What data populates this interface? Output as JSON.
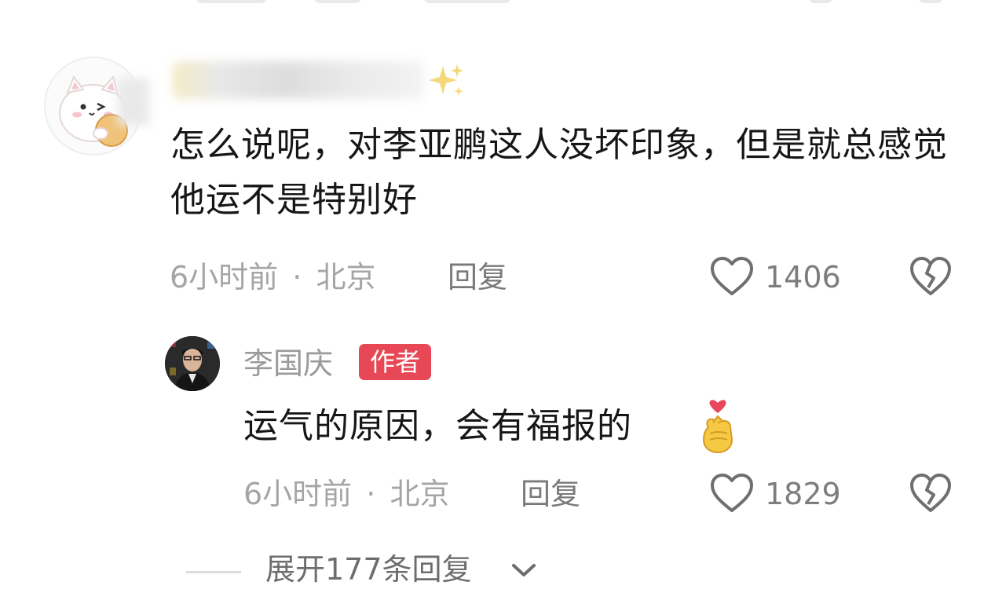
{
  "comment": {
    "text": "怎么说呢，对李亚鹏这人没坏印象，但是就总感觉他运不是特别好",
    "time": "6小时前",
    "location": "北京",
    "reply_label": "回复",
    "likes": "1406",
    "icons": {
      "avatar": "cat-avatar-icon",
      "like": "heart-outline-icon",
      "dislike": "broken-heart-icon",
      "name_suffix": "sparkles-icon"
    }
  },
  "reply": {
    "author": "李国庆",
    "badge": "作者",
    "badge_color": "#e84855",
    "text": "运气的原因，会有福报的",
    "time": "6小时前",
    "location": "北京",
    "reply_label": "回复",
    "likes": "1829",
    "icons": {
      "avatar": "author-photo-avatar",
      "emoji": "finger-heart-emoji-icon",
      "like": "heart-outline-icon",
      "dislike": "broken-heart-icon"
    }
  },
  "expand": {
    "label": "展开177条回复",
    "icon": "chevron-down-icon"
  },
  "separator": "·"
}
